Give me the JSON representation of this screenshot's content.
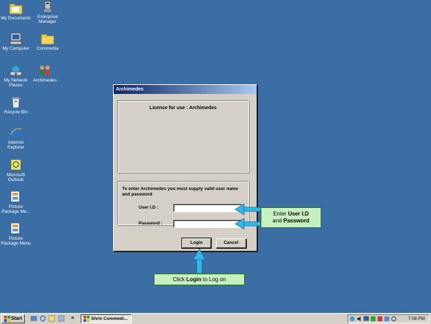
{
  "desktop": {
    "icons": [
      {
        "label": "My Documents",
        "icon": "folder-documents-icon"
      },
      {
        "label": "Enterprise Manager",
        "icon": "enterprise-manager-icon"
      },
      {
        "label": "My Computer",
        "icon": "computer-icon"
      },
      {
        "label": "Commedia",
        "icon": "folder-icon"
      },
      {
        "label": "My Network Places",
        "icon": "network-icon"
      },
      {
        "label": "Archimedes",
        "icon": "archimedes-icon"
      },
      {
        "label": "Recycle Bin",
        "icon": "recycle-bin-icon"
      },
      {
        "label": "Internet Explorer",
        "icon": "ie-icon"
      },
      {
        "label": "Microsoft Outlook",
        "icon": "outlook-icon"
      },
      {
        "label": "Picture Package Me...",
        "icon": "picture-package-icon"
      },
      {
        "label": "Picture Package Menu",
        "icon": "picture-package-icon"
      }
    ]
  },
  "dialog": {
    "title": "Archimedes",
    "licence": "Licence for use : Archimedes",
    "instructions": "To enter Archimedes you must supply valid user name and password",
    "user_label": "User   I.D :",
    "user_value": "",
    "password_label": "Password :",
    "password_value": "",
    "login_label": "Login",
    "cancel_label": "Cancel"
  },
  "callouts": {
    "enter_prefix": "Enter",
    "enter_user": "User I.D",
    "enter_and": "and",
    "enter_password": "Password",
    "click_prefix": "Click",
    "click_login": "Login",
    "click_suffix": "to Log on"
  },
  "taskbar": {
    "start_label": "Start",
    "task_label": "Shriv Commedi...",
    "chevron": "»",
    "clock": "7:08 PM"
  },
  "colors": {
    "desktop": "#3a6ea5",
    "titlebar_start": "#0a246a",
    "callout_bg": "#c7f0c0",
    "arrow": "#2fb8e8"
  }
}
